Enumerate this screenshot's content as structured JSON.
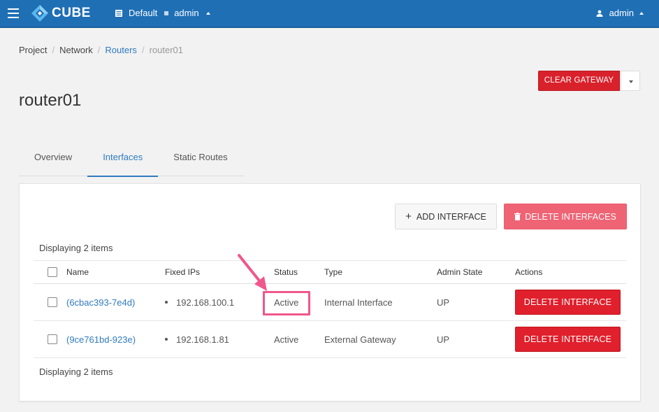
{
  "header": {
    "brand": "CUBE",
    "domain": "Default",
    "project": "admin",
    "user": "admin"
  },
  "breadcrumb": [
    "Project",
    "Network",
    "Routers",
    "router01"
  ],
  "page": {
    "title": "router01",
    "clear_gateway_label": "CLEAR GATEWAY"
  },
  "tabs": [
    {
      "label": "Overview"
    },
    {
      "label": "Interfaces"
    },
    {
      "label": "Static Routes"
    }
  ],
  "panel": {
    "add_label": "ADD INTERFACE",
    "delete_multi_label": "DELETE INTERFACES",
    "count_text": "Displaying 2 items",
    "columns": [
      "Name",
      "Fixed IPs",
      "Status",
      "Type",
      "Admin State",
      "Actions"
    ],
    "rows": [
      {
        "name": "(6cbac393-7e4d)",
        "ip": "192.168.100.1",
        "status": "Active",
        "type": "Internal Interface",
        "admin": "UP",
        "action": "DELETE INTERFACE"
      },
      {
        "name": "(9ce761bd-923e)",
        "ip": "192.168.1.81",
        "status": "Active",
        "type": "External Gateway",
        "admin": "UP",
        "action": "DELETE INTERFACE"
      }
    ]
  },
  "colors": {
    "topbar": "#1f6fb5",
    "link": "#2f7bbf",
    "danger": "#e0202c",
    "danger_light": "#ef6475",
    "annotation": "#f0578a"
  },
  "icons": {
    "menu": "hamburger-icon",
    "logo": "cube-logo-icon",
    "project": "grid-icon",
    "user": "user-icon",
    "add": "plus-icon",
    "delete": "trash-icon"
  }
}
